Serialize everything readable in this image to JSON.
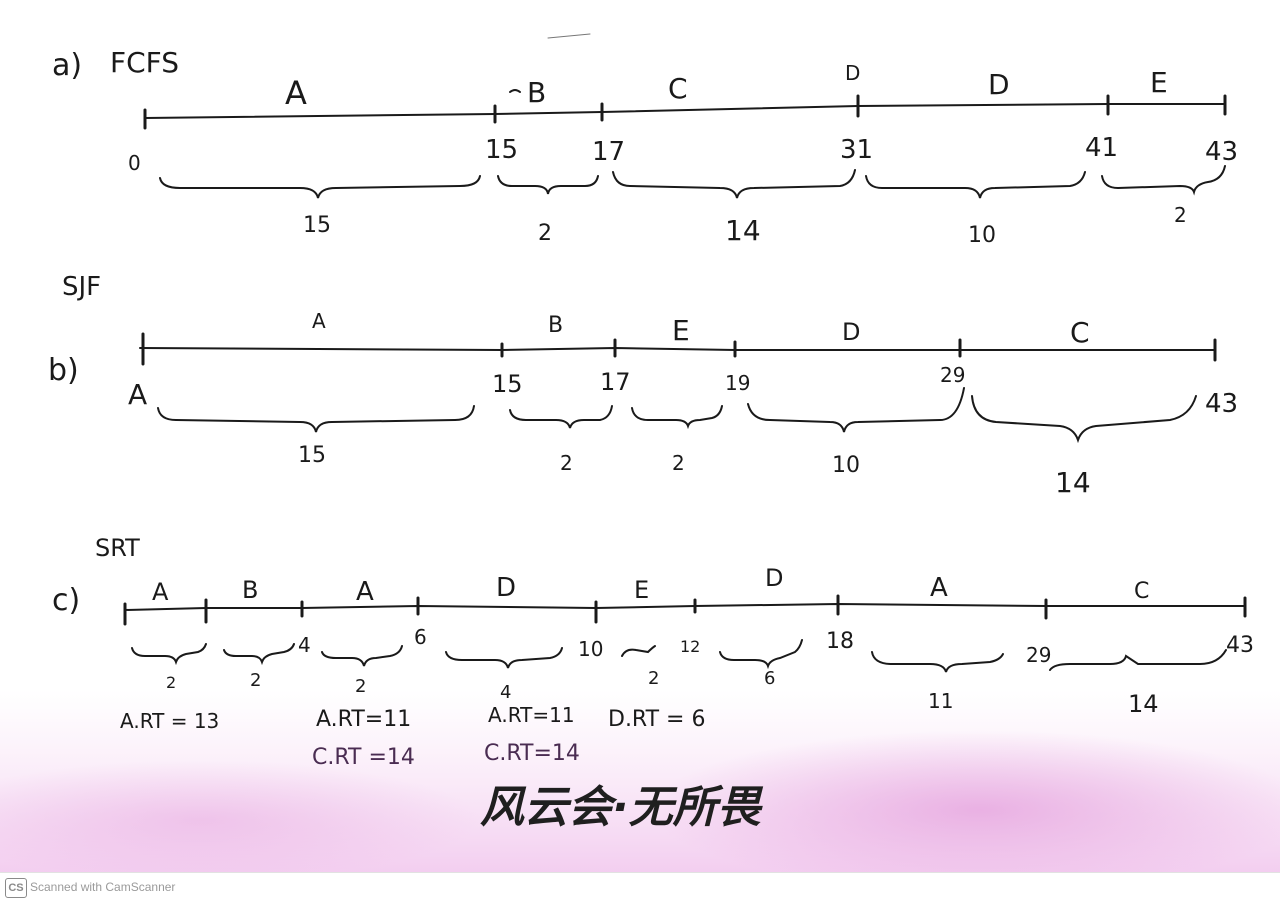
{
  "colors": {
    "ink": "#1a1a1a",
    "purple_ink": "#4a2c52",
    "pink_wash": "#e7a8e0",
    "logo_ink": "#1f1f1f"
  },
  "sections": [
    {
      "label": "a)",
      "title": "FCFS",
      "segments": [
        "A",
        "B",
        "C",
        "D",
        "D",
        "E"
      ],
      "ticks": [
        "0",
        "15",
        "17",
        "31",
        "41",
        "43"
      ],
      "durations": [
        "15",
        "2",
        "14",
        "10",
        "2"
      ]
    },
    {
      "label": "b)",
      "title": "SJF",
      "segments": [
        "A",
        "B",
        "E",
        "D",
        "C"
      ],
      "ticks": [
        "A",
        "15",
        "17",
        "19",
        "29",
        "43"
      ],
      "durations": [
        "15",
        "2",
        "2",
        "10",
        "14"
      ]
    },
    {
      "label": "c)",
      "title": "SRT",
      "segments": [
        "A",
        "B",
        "A",
        "D",
        "E",
        "D",
        "A",
        "C"
      ],
      "ticks": [
        "4",
        "6",
        "10",
        "12",
        "18",
        "29",
        "43"
      ],
      "durations": [
        "2",
        "2",
        "2",
        "4",
        "2",
        "6",
        "11",
        "14"
      ],
      "notes": [
        "A.RT = 13",
        "A.RT=11",
        "A.RT=11",
        "D.RT = 6"
      ],
      "notes_purple": [
        "C.RT =14",
        "C.RT=14"
      ]
    }
  ],
  "watermark": "风云会·无所畏",
  "footer": {
    "logo": "CS",
    "text": "Scanned with CamScanner"
  }
}
